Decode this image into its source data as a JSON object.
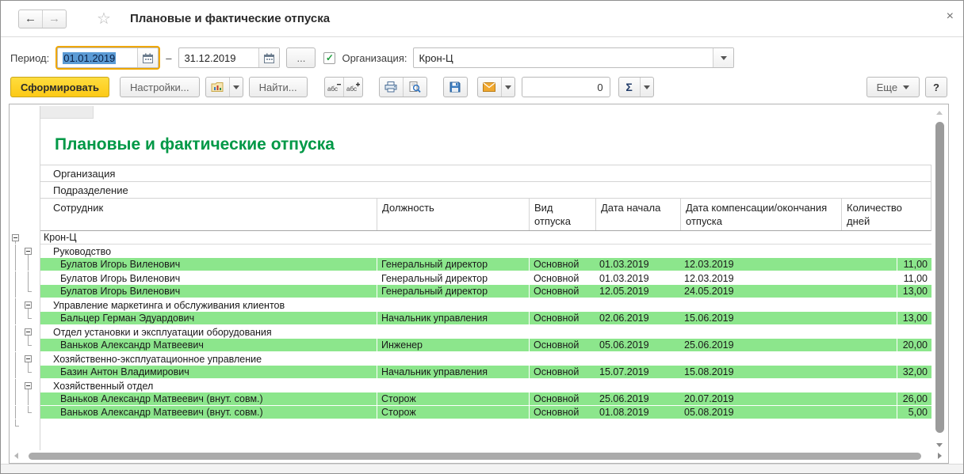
{
  "titlebar": {
    "back_glyph": "←",
    "forward_glyph": "→",
    "star_glyph": "☆",
    "title": "Плановые и фактические отпуска",
    "close_glyph": "×"
  },
  "filters": {
    "period_label": "Период:",
    "period_from": "01.01.2019",
    "range_dash": "–",
    "period_to": "31.12.2019",
    "more_periods_label": "...",
    "org_checked": true,
    "org_check_glyph": "✓",
    "org_label": "Организация:",
    "org_value": "Крон-Ц"
  },
  "toolbar": {
    "generate_label": "Сформировать",
    "settings_label": "Настройки...",
    "find_label": "Найти...",
    "counter_value": "0",
    "sigma_glyph": "Σ",
    "more_label": "Еще",
    "help_label": "?"
  },
  "report": {
    "title": "Плановые и фактические отпуска",
    "org_section_label": "Организация",
    "dept_section_label": "Подразделение",
    "columns": [
      "Сотрудник",
      "Должность",
      "Вид отпуска",
      "Дата начала",
      "Дата компенсации/окончания отпуска",
      "Количество дней"
    ],
    "rows": [
      {
        "kind": "group1",
        "label": "Крон-Ц",
        "t1": "box",
        "t2": null
      },
      {
        "kind": "group2",
        "label": "Руководство",
        "t1": "line",
        "t2": "box"
      },
      {
        "kind": "data",
        "green": true,
        "t1": "line",
        "t2": "line",
        "cells": [
          "Булатов Игорь Виленович",
          "Генеральный директор",
          "Основной",
          "01.03.2019",
          "12.03.2019",
          "11,00"
        ]
      },
      {
        "kind": "data",
        "green": false,
        "t1": "line",
        "t2": "line",
        "cells": [
          "Булатов Игорь Виленович",
          "Генеральный директор",
          "Основной",
          "01.03.2019",
          "12.03.2019",
          "11,00"
        ]
      },
      {
        "kind": "data",
        "green": true,
        "t1": "line",
        "t2": "elbow",
        "cells": [
          "Булатов Игорь Виленович",
          "Генеральный директор",
          "Основной",
          "12.05.2019",
          "24.05.2019",
          "13,00"
        ]
      },
      {
        "kind": "group2",
        "label": "Управление маркетинга и обслуживания клиентов",
        "t1": "line",
        "t2": "box"
      },
      {
        "kind": "data",
        "green": true,
        "t1": "line",
        "t2": "elbow",
        "cells": [
          "Бальцер Герман Эдуардович",
          "Начальник управления",
          "Основной",
          "02.06.2019",
          "15.06.2019",
          "13,00"
        ]
      },
      {
        "kind": "group2",
        "label": "Отдел установки и эксплуатации оборудования",
        "t1": "line",
        "t2": "box"
      },
      {
        "kind": "data",
        "green": true,
        "t1": "line",
        "t2": "elbow",
        "cells": [
          "Ваньков Александр Матвеевич",
          "Инженер",
          "Основной",
          "05.06.2019",
          "25.06.2019",
          "20,00"
        ]
      },
      {
        "kind": "group2",
        "label": "Хозяйственно-эксплуатационное управление",
        "t1": "line",
        "t2": "box"
      },
      {
        "kind": "data",
        "green": true,
        "t1": "line",
        "t2": "elbow",
        "cells": [
          "Базин Антон Владимирович",
          "Начальник управления",
          "Основной",
          "15.07.2019",
          "15.08.2019",
          "32,00"
        ]
      },
      {
        "kind": "group2",
        "label": "Хозяйственный отдел",
        "t1": "line",
        "t2": "box"
      },
      {
        "kind": "data",
        "green": true,
        "t1": "line",
        "t2": "line",
        "cells": [
          "Ваньков Александр Матвеевич (внут. совм.)",
          "Сторож",
          "Основной",
          "25.06.2019",
          "20.07.2019",
          "26,00"
        ]
      },
      {
        "kind": "data",
        "green": true,
        "t1": "line",
        "t2": "elbow",
        "cells": [
          "Ваньков Александр Матвеевич (внут. совм.)",
          "Сторож",
          "Основной",
          "01.08.2019",
          "05.08.2019",
          "5,00"
        ]
      },
      {
        "kind": "spacer",
        "label": "",
        "t1": "elbow",
        "t2": null
      }
    ]
  },
  "colors": {
    "title_green": "#009846",
    "row_green": "#8ce68c",
    "generate_yellow": "#ffd21e",
    "focus_ring_orange": "#efa700",
    "selection_blue": "#5b9bd5"
  }
}
